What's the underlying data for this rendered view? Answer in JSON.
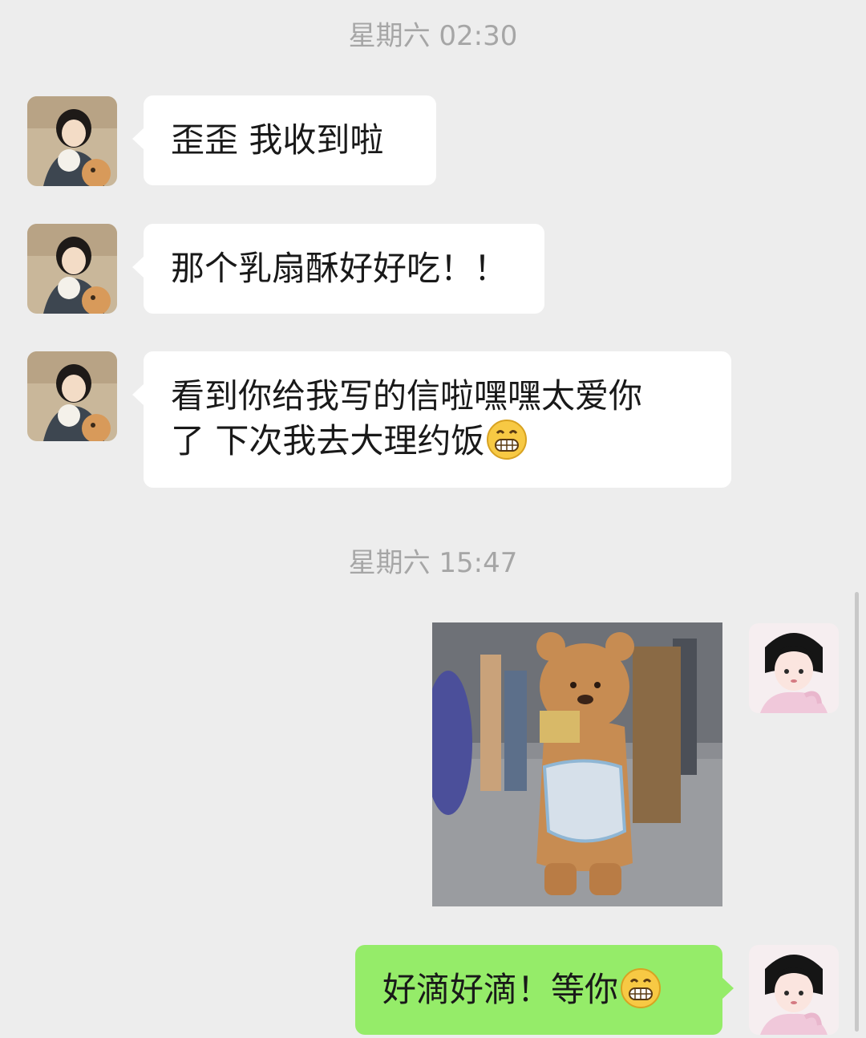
{
  "chat": {
    "timestamps": [
      "星期六 02:30",
      "星期六 15:47"
    ],
    "incoming": [
      {
        "text": "歪歪 我收到啦",
        "avatar": "girl-with-dog-avatar"
      },
      {
        "text": "那个乳扇酥好好吃！！",
        "avatar": "girl-with-dog-avatar"
      },
      {
        "text_line1": "看到你给我写的信啦嘿嘿太爱你",
        "text_line2": "了 下次我去大理约饭",
        "emoji": "grinning-face-emoji",
        "avatar": "girl-with-dog-avatar"
      }
    ],
    "outgoing": [
      {
        "type": "image",
        "description_icon": "bear-mascot-photo",
        "avatar": "illustrated-girl-avatar"
      },
      {
        "text": "好滴好滴！等你",
        "emoji": "grinning-face-emoji",
        "avatar": "illustrated-girl-avatar"
      }
    ]
  },
  "colors": {
    "background": "#ededed",
    "incoming_bubble": "#ffffff",
    "outgoing_bubble": "#95ec69",
    "timestamp_text": "#a6a6a6",
    "message_text": "#191919"
  }
}
